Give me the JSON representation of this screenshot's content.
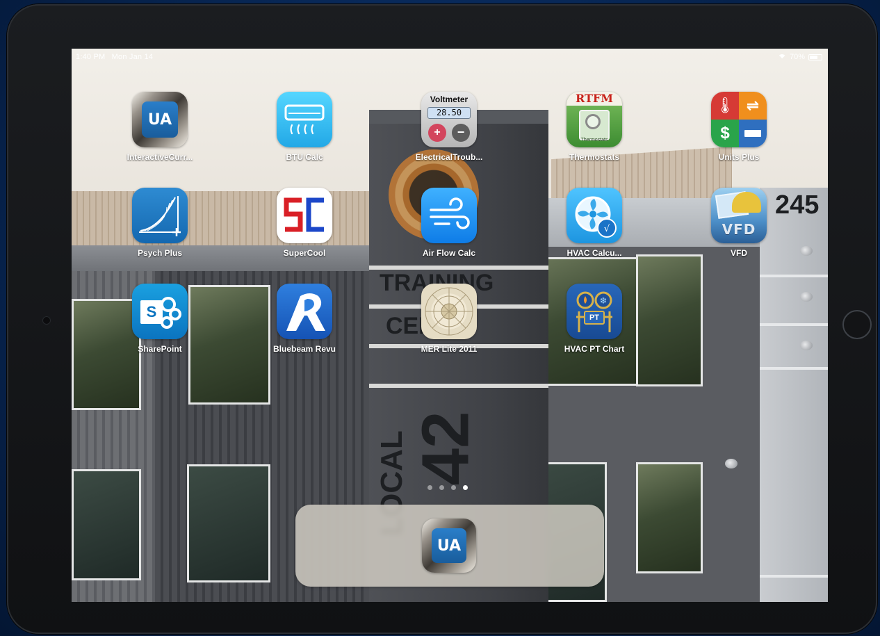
{
  "status_bar": {
    "time": "1:40 PM",
    "date": "Mon Jan 14",
    "battery": "70%",
    "battery_level": 0.7
  },
  "wallpaper": {
    "sign_number": "245",
    "tower_text_1": "TRAINING",
    "tower_text_2": "CEN",
    "tower_vertical_1": "LOCAL",
    "tower_vertical_2": "42"
  },
  "apps": [
    {
      "id": "interactive-curriculum",
      "label": "InteractiveCurr...",
      "icon": "ua-logo-icon",
      "icon_text": "UA"
    },
    {
      "id": "btu-calc",
      "label": "BTU Calc",
      "icon": "air-conditioner-icon"
    },
    {
      "id": "electrical-troubleshooting",
      "label": "ElectricalTroub...",
      "icon": "voltmeter-icon",
      "icon_title": "Voltmeter",
      "icon_reading": "28.50"
    },
    {
      "id": "thermostats",
      "label": "Thermostats",
      "icon": "rtfm-manual-icon",
      "icon_title": "RTFM",
      "icon_sub": "Thermostats"
    },
    {
      "id": "units-plus",
      "label": "Units Plus",
      "icon": "units-converter-icon"
    },
    {
      "id": "psych-plus",
      "label": "Psych Plus",
      "icon": "psychrometric-chart-icon"
    },
    {
      "id": "supercool",
      "label": "SuperCool",
      "icon": "sc-logo-icon",
      "icon_text": "SC"
    },
    {
      "id": "air-flow-calc",
      "label": "Air Flow Calc",
      "icon": "wind-icon"
    },
    {
      "id": "hvac-calculator",
      "label": "HVAC Calcu...",
      "icon": "fan-calculator-icon"
    },
    {
      "id": "vfd",
      "label": "VFD",
      "icon": "vfd-icon",
      "icon_text": "VFD"
    },
    {
      "id": "sharepoint",
      "label": "SharePoint",
      "icon": "sharepoint-icon",
      "icon_text": "S"
    },
    {
      "id": "bluebeam-revu",
      "label": "Bluebeam Revu",
      "icon": "bluebeam-icon"
    },
    {
      "id": "mer-lite-2011",
      "label": "MER Lite 2011",
      "icon": "formula-wheel-icon"
    },
    {
      "id": "hvac-pt-chart",
      "label": "HVAC PT Chart",
      "icon": "pt-gauges-icon",
      "icon_text": "PT"
    }
  ],
  "pages": {
    "count": 4,
    "current": 4
  },
  "dock": {
    "apps": [
      {
        "id": "dock-ua",
        "icon": "ua-logo-icon",
        "icon_text": "UA"
      }
    ]
  }
}
